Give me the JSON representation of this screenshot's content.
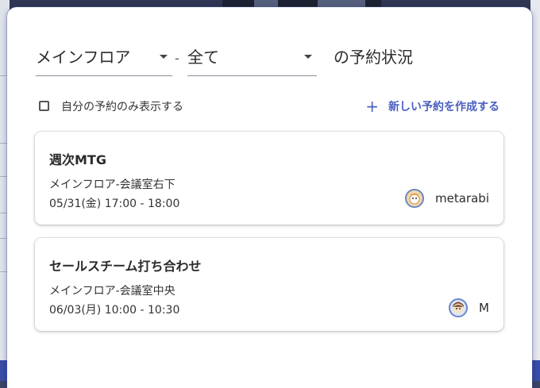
{
  "filter": {
    "floor_value": "メインフロア",
    "separator": "-",
    "room_value": "全て",
    "suffix": "の予約状況"
  },
  "options": {
    "only_mine_label": "自分の予約のみ表示する",
    "only_mine_checked": false,
    "create_label": "新しい予約を作成する"
  },
  "reservations": [
    {
      "title": "週次MTG",
      "room": "メインフロア-会議室右下",
      "time": "05/31(金) 17:00 - 18:00",
      "user": "metarabi"
    },
    {
      "title": "セールスチーム打ち合わせ",
      "room": "メインフロア-会議室中央",
      "time": "06/03(月) 10:00 - 10:30",
      "user": "M"
    }
  ],
  "colors": {
    "accent": "#4a5fc1",
    "avatar_bg": "#f3d9a8",
    "avatar_ring": "#6b86c9"
  }
}
